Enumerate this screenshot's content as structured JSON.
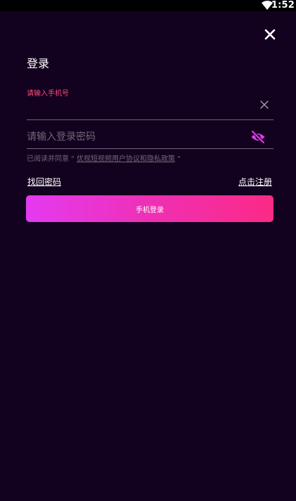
{
  "status_bar": {
    "time": "1:52",
    "icons": [
      "wifi-icon"
    ]
  },
  "header": {
    "close_icon": "close-icon"
  },
  "form": {
    "title": "登录",
    "phone_label": "请输入手机号",
    "phone_value": "",
    "password_placeholder": "请输入登录密码",
    "password_value": "",
    "clear_icon": "clear-icon",
    "eye_icon": "eye-off-icon"
  },
  "agreement": {
    "prefix": "已阅读并同意 \" ",
    "link_text": "优视短视频用户协议和隐私政策",
    "suffix": " \""
  },
  "links": {
    "forgot_password": "找回密码",
    "register": "点击注册"
  },
  "login_button": {
    "label": "手机登录"
  },
  "colors": {
    "background": "#13021f",
    "accent_pink": "#ff4b7d",
    "eye_icon": "#e43af0",
    "button_start": "#e43af0",
    "button_end": "#fb2a86",
    "divider": "#6d6477",
    "muted_text": "#6f6878"
  }
}
